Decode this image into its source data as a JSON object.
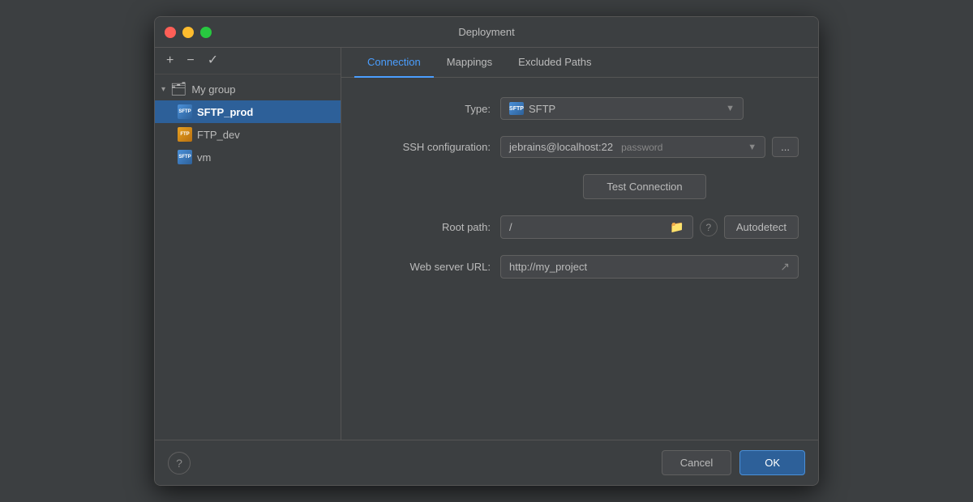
{
  "dialog": {
    "title": "Deployment"
  },
  "traffic_lights": {
    "close_label": "close",
    "minimize_label": "minimize",
    "maximize_label": "maximize"
  },
  "sidebar": {
    "add_label": "+",
    "remove_label": "−",
    "check_label": "✓",
    "group": {
      "name": "My group",
      "chevron": "▾",
      "icon": "🗂"
    },
    "items": [
      {
        "id": "sftp_prod",
        "label": "SFTP_prod",
        "type": "SFTP",
        "selected": true,
        "icon_text": "SFTP"
      },
      {
        "id": "ftp_dev",
        "label": "FTP_dev",
        "type": "FTP",
        "selected": false,
        "icon_text": "FTP"
      },
      {
        "id": "vm",
        "label": "vm",
        "type": "SFTP",
        "selected": false,
        "icon_text": "SFTP"
      }
    ]
  },
  "tabs": [
    {
      "id": "connection",
      "label": "Connection",
      "active": true
    },
    {
      "id": "mappings",
      "label": "Mappings",
      "active": false
    },
    {
      "id": "excluded_paths",
      "label": "Excluded Paths",
      "active": false
    }
  ],
  "form": {
    "type_label": "Type:",
    "type_value": "SFTP",
    "type_icon": "SFTP",
    "ssh_label": "SSH configuration:",
    "ssh_value": "jebrains@localhost:22",
    "ssh_auth_type": "password",
    "ellipsis_label": "...",
    "test_connection_label": "Test Connection",
    "root_path_label": "Root path:",
    "root_path_value": "/",
    "autodetect_label": "Autodetect",
    "web_url_label": "Web server URL:",
    "web_url_value": "http://my_project"
  },
  "footer": {
    "help_label": "?",
    "cancel_label": "Cancel",
    "ok_label": "OK"
  }
}
